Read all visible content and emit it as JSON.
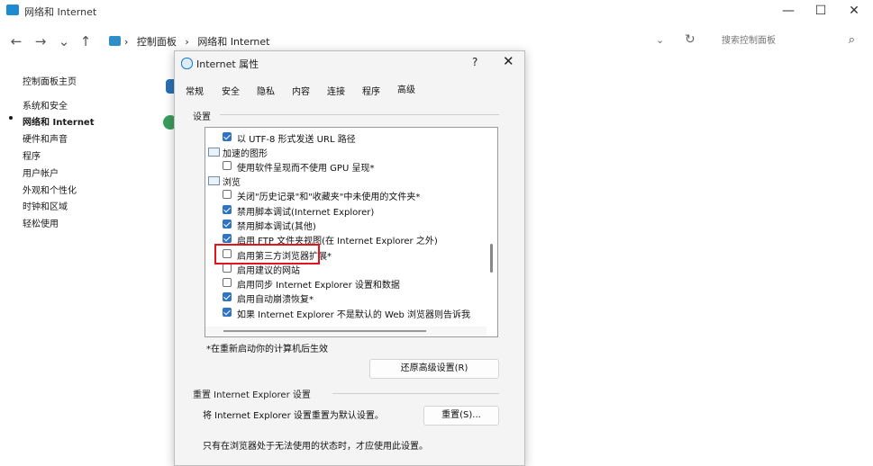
{
  "window": {
    "title": "网络和 Internet",
    "minimize": "—",
    "maximize": "☐",
    "close": "✕"
  },
  "address": {
    "back": "←",
    "forward": "→",
    "history": "⌄",
    "up": "↑",
    "crumbs": [
      "›",
      "控制面板",
      "›",
      "网络和 Internet"
    ],
    "dropdown": "⌄",
    "refresh": "↻",
    "search_placeholder": "搜索控制面板",
    "search_icon": "⌕"
  },
  "sidebar": {
    "items": [
      {
        "label": "控制面板主页"
      },
      {
        "label": "系统和安全"
      },
      {
        "label": "网络和 Internet",
        "active": true
      },
      {
        "label": "硬件和声音"
      },
      {
        "label": "程序"
      },
      {
        "label": "用户帐户"
      },
      {
        "label": "外观和个性化"
      },
      {
        "label": "时钟和区域"
      },
      {
        "label": "轻松使用"
      }
    ]
  },
  "dialog": {
    "title": "Internet 属性",
    "help": "?",
    "close": "✕",
    "tabs": [
      "常规",
      "安全",
      "隐私",
      "内容",
      "连接",
      "程序",
      "高级"
    ],
    "settings_label": "设置",
    "settings": [
      {
        "type": "check",
        "checked": true,
        "label": "以 UTF-8 形式发送 URL 路径"
      },
      {
        "type": "category",
        "label": "加速的图形"
      },
      {
        "type": "check",
        "checked": false,
        "label": "使用软件呈现而不使用 GPU 呈现*"
      },
      {
        "type": "category",
        "label": "浏览"
      },
      {
        "type": "check",
        "checked": false,
        "label": "关闭\"历史记录\"和\"收藏夹\"中未使用的文件夹*"
      },
      {
        "type": "check",
        "checked": true,
        "label": "禁用脚本调试(Internet Explorer)"
      },
      {
        "type": "check",
        "checked": true,
        "label": "禁用脚本调试(其他)"
      },
      {
        "type": "check",
        "checked": true,
        "label": "启用 FTP 文件夹视图(在 Internet Explorer 之外)"
      },
      {
        "type": "check",
        "checked": false,
        "label": "启用第三方浏览器扩展*"
      },
      {
        "type": "check",
        "checked": false,
        "label": "启用建议的网站"
      },
      {
        "type": "check",
        "checked": false,
        "label": "启用同步 Internet Explorer 设置和数据"
      },
      {
        "type": "check",
        "checked": true,
        "label": "启用自动崩溃恢复*"
      },
      {
        "type": "check",
        "checked": true,
        "label": "如果 Internet Explorer 不是默认的 Web 浏览器则告诉我"
      }
    ],
    "restart_note": "*在重新启动你的计算机后生效",
    "restore_button": "还原高级设置(R)",
    "reset_group_label": "重置 Internet Explorer 设置",
    "reset_description": "将 Internet Explorer 设置重置为默认设置。",
    "reset_button": "重置(S)...",
    "reset_note": "只有在浏览器处于无法使用的状态时，才应使用此设置。"
  },
  "colors": {
    "accent": "#2e73c4",
    "highlight": "#e5131b"
  }
}
